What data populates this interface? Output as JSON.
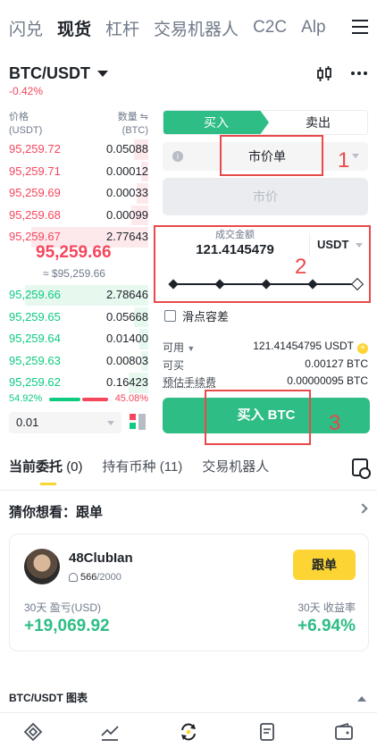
{
  "top_tabs": [
    "闪兑",
    "现货",
    "杠杆",
    "交易机器人",
    "C2C",
    "Alp"
  ],
  "pair": {
    "symbol": "BTC/USDT",
    "change": "-0.42%"
  },
  "orderbook": {
    "price_label": "价格",
    "price_unit": "(USDT)",
    "qty_label": "数量 ⇋",
    "qty_unit": "(BTC)",
    "asks": [
      {
        "price": "95,259.72",
        "qty": "0.05088",
        "depth": 0.1
      },
      {
        "price": "95,259.71",
        "qty": "0.00012",
        "depth": 0.05
      },
      {
        "price": "95,259.69",
        "qty": "0.00033",
        "depth": 0.08
      },
      {
        "price": "95,259.68",
        "qty": "0.00099",
        "depth": 0.12
      },
      {
        "price": "95,259.67",
        "qty": "2.77643",
        "depth": 0.82
      }
    ],
    "mid_price": "95,259.66",
    "mid_sub": "≈ $95,259.66",
    "bids": [
      {
        "price": "95,259.66",
        "qty": "2.78646",
        "depth": 0.86
      },
      {
        "price": "95,259.65",
        "qty": "0.05668",
        "depth": 0.1
      },
      {
        "price": "95,259.64",
        "qty": "0.01400",
        "depth": 0.06
      },
      {
        "price": "95,259.63",
        "qty": "0.00803",
        "depth": 0.05
      },
      {
        "price": "95,259.62",
        "qty": "0.16423",
        "depth": 0.14
      }
    ],
    "buy_ratio": "54.92%",
    "sell_ratio": "45.08%",
    "precision": "0.01"
  },
  "form": {
    "buy_tab": "买入",
    "sell_tab": "卖出",
    "order_type": "市价单",
    "price_placeholder": "市价",
    "amount_label": "成交金额",
    "amount_value": "121.4145479",
    "amount_unit": "USDT",
    "slider_level": 1.0,
    "slippage": "滑点容差",
    "available_label": "可用",
    "available_value": "121.41454795 USDT",
    "can_buy_label": "可买",
    "can_buy_value": "0.00127 BTC",
    "fee_label": "预估手续费",
    "fee_value": "0.00000095 BTC",
    "buy_button": "买入 BTC"
  },
  "annotations": [
    "1",
    "2",
    "3"
  ],
  "orders_tabs": [
    "当前委托",
    "(0)",
    "持有币种",
    "(11)",
    "交易机器人"
  ],
  "guess": "猜你想看：跟单",
  "trader": {
    "name": "48ClubIan",
    "followers": "566",
    "followers_max": "/2000",
    "follow_button": "跟单",
    "pnl_label": "30天 盈亏(USD)",
    "pnl_value": "+19,069.92",
    "roi_label": "30天 收益率",
    "roi_value": "+6.94%"
  },
  "chart_bar": "BTC/USDT 图表",
  "colors": {
    "buy": "#2ebd85",
    "sell": "#f6465d",
    "accent": "#fcd535",
    "annotation": "#e84a4a"
  }
}
